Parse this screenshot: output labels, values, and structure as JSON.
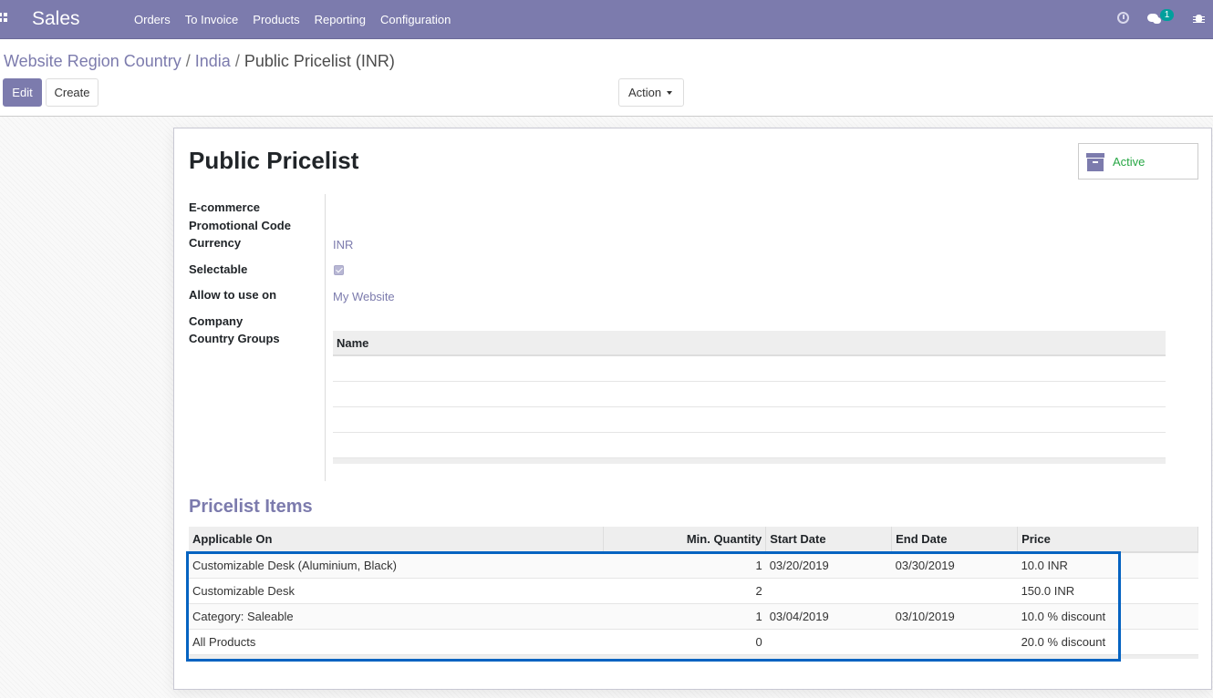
{
  "navbar": {
    "app_name": "Sales",
    "menu": [
      "Orders",
      "To Invoice",
      "Products",
      "Reporting",
      "Configuration"
    ],
    "message_count": "1",
    "bg_color": "#7c7bad"
  },
  "breadcrumb": {
    "items": [
      "Website Region Country",
      "India"
    ],
    "current": "Public Pricelist (INR)"
  },
  "buttons": {
    "edit": "Edit",
    "create": "Create",
    "action": "Action"
  },
  "record": {
    "title": "Public Pricelist",
    "status_button": "Active",
    "fields": {
      "ecommerce_label": "E-commerce",
      "promo_label": "Promotional Code",
      "currency_label": "Currency",
      "currency_value": "INR",
      "selectable_label": "Selectable",
      "selectable_checked": true,
      "allow_label": "Allow to use on",
      "allow_value": "My Website",
      "company_label": "Company",
      "country_groups_label": "Country Groups"
    },
    "country_groups_table": {
      "header": "Name"
    }
  },
  "pricelist_items": {
    "section_title": "Pricelist Items",
    "columns": [
      "Applicable On",
      "Min. Quantity",
      "Start Date",
      "End Date",
      "Price"
    ],
    "rows": [
      [
        "Customizable Desk (Aluminium, Black)",
        "1",
        "03/20/2019",
        "03/30/2019",
        "10.0 INR"
      ],
      [
        "Customizable Desk",
        "2",
        "",
        "",
        "150.0 INR"
      ],
      [
        "Category: Saleable",
        "1",
        "03/04/2019",
        "03/10/2019",
        "10.0 % discount"
      ],
      [
        "All Products",
        "0",
        "",
        "",
        "20.0 % discount"
      ]
    ]
  }
}
